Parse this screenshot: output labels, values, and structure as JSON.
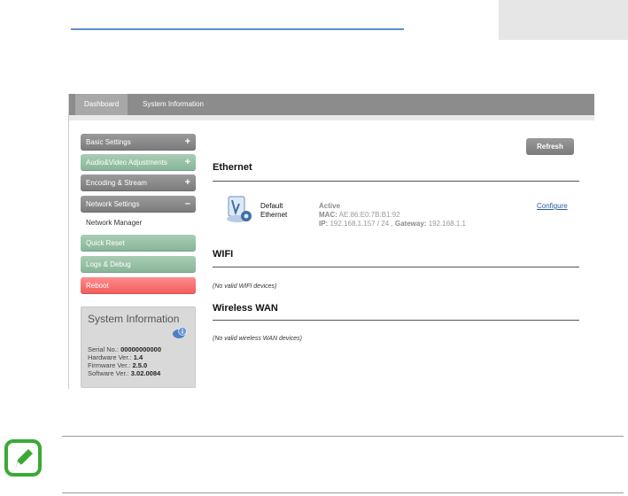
{
  "tabs": [
    {
      "label": "Dashboard",
      "active": true
    },
    {
      "label": "System Information",
      "active": false
    }
  ],
  "sidebar": {
    "items": [
      {
        "label": "Basic Settings",
        "style": "gray",
        "expand": "+"
      },
      {
        "label": "Audio&Video Adjustments",
        "style": "green",
        "expand": "+"
      },
      {
        "label": "Encoding & Stream",
        "style": "gray",
        "expand": "+"
      },
      {
        "label": "Network Settings",
        "style": "gray",
        "expand": "–"
      },
      {
        "label": "Quick Reset",
        "style": "green"
      },
      {
        "label": "Logs & Debug",
        "style": "green"
      },
      {
        "label": "Reboot",
        "style": "red"
      }
    ],
    "sub_item": "Network Manager"
  },
  "system_info": {
    "title": "System Information",
    "serial_label": "Serial No.:",
    "serial": "00000000000",
    "hardware_label": "Hardware Ver.:",
    "hardware": "1.4",
    "firmware_label": "Firmware Ver.:",
    "firmware": "2.5.0",
    "software_label": "Software Ver.:",
    "software": "3.02.0084"
  },
  "refresh_label": "Refresh",
  "ethernet": {
    "title": "Ethernet",
    "name_line1": "Default",
    "name_line2": "Ethernet",
    "status": "Active",
    "mac_label": "MAC:",
    "mac": "AE:86:E0:7B:B1:92",
    "ip_label": "IP:",
    "ip": "192.168.1.157 / 24",
    "gateway_label": "Gateway:",
    "gateway": "192.168.1.1",
    "configure_label": "Configure"
  },
  "wifi": {
    "title": "WIFI",
    "note": "(No valid WIFI devices)"
  },
  "wwan": {
    "title": "Wireless WAN",
    "note": "(No valid wireless WAN devices)"
  },
  "colors": {
    "accent_blue": "#5b8fc8",
    "reboot_red": "#f25a5a",
    "green_btn": "#86b597",
    "note_green": "#3aaa35"
  }
}
